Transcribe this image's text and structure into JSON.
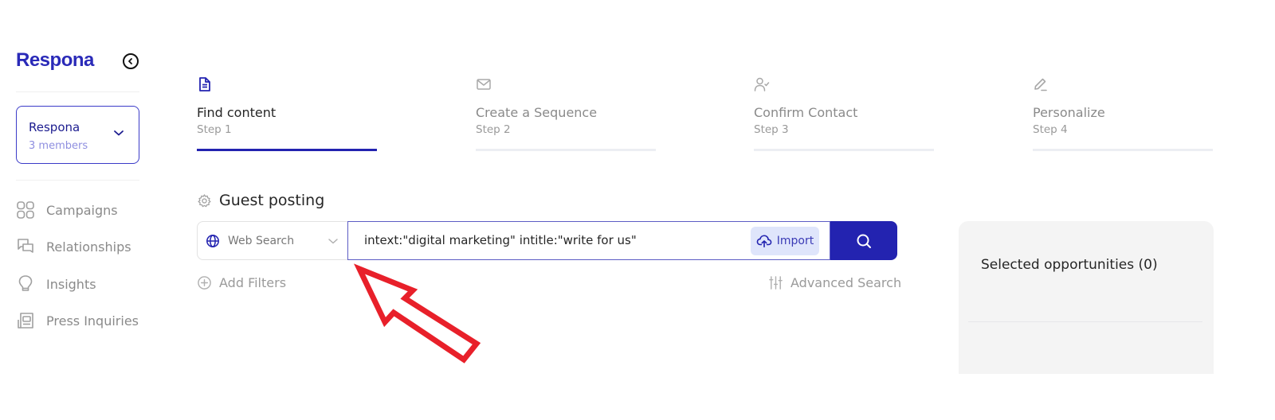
{
  "sidebar": {
    "logo": "Respona",
    "collapse_icon": "chevron-left-circle-icon",
    "workspace": {
      "name": "Respona",
      "members": "3 members"
    },
    "nav_items": [
      {
        "label": "Campaigns",
        "icon": "grid-icon"
      },
      {
        "label": "Relationships",
        "icon": "chat-bubbles-icon"
      },
      {
        "label": "Insights",
        "icon": "lightbulb-icon"
      },
      {
        "label": "Press Inquiries",
        "icon": "newspaper-icon"
      }
    ]
  },
  "steps": [
    {
      "title": "Find content",
      "sub": "Step 1",
      "icon": "document-icon",
      "active": true
    },
    {
      "title": "Create a Sequence",
      "sub": "Step 2",
      "icon": "mail-icon",
      "active": false
    },
    {
      "title": "Confirm Contact",
      "sub": "Step 3",
      "icon": "user-check-icon",
      "active": false
    },
    {
      "title": "Personalize",
      "sub": "Step 4",
      "icon": "pencil-icon",
      "active": false
    }
  ],
  "campaign": {
    "title": "Guest posting",
    "icon": "gear-icon"
  },
  "search": {
    "type_label": "Web Search",
    "query": "intext:\"digital marketing\" intitle:\"write for us\"",
    "import_label": "Import",
    "add_filters_label": "Add Filters",
    "advanced_search_label": "Advanced Search"
  },
  "opportunities": {
    "title": "Selected opportunities (0)"
  },
  "colors": {
    "brand": "#2323b0",
    "annotation_arrow": "#e8202a",
    "import_bg": "#dfe5fb",
    "panel_bg": "#f4f4f4"
  }
}
